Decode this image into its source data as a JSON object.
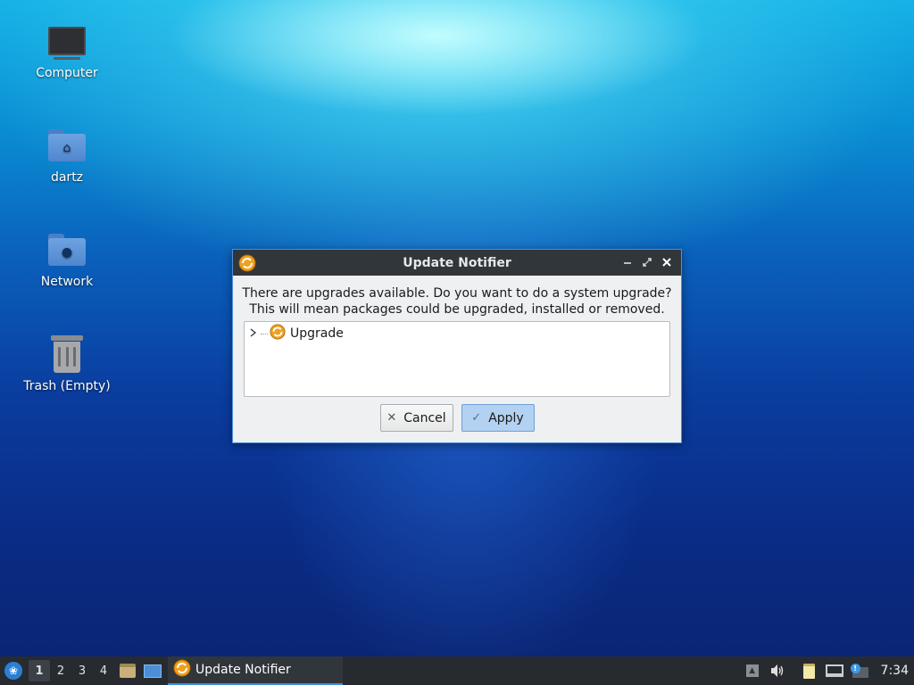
{
  "desktop": {
    "icons": [
      {
        "label": "Computer",
        "icon": "computer-icon"
      },
      {
        "label": "dartz",
        "icon": "home-folder-icon"
      },
      {
        "label": "Network",
        "icon": "network-folder-icon"
      },
      {
        "label": "Trash (Empty)",
        "icon": "trash-icon"
      }
    ]
  },
  "dialog": {
    "title": "Update Notifier",
    "message_line1": "There are upgrades available. Do you want to do a system upgrade?",
    "message_line2": "This will mean packages could be upgraded, installed or removed.",
    "tree": [
      {
        "label": "Upgrade",
        "expanded": false
      }
    ],
    "buttons": {
      "cancel": "Cancel",
      "apply": "Apply"
    },
    "controls": [
      "minimize",
      "maximize",
      "close"
    ]
  },
  "taskbar": {
    "desktops": [
      "1",
      "2",
      "3",
      "4"
    ],
    "active_desktop": "1",
    "task_label": "Update Notifier",
    "clock": "7:34"
  },
  "colors": {
    "titlebar": "#31363b",
    "dialog_border": "#4a90d9",
    "apply_button": "#b3d1f0",
    "taskbar": "#272b30",
    "update_icon": "#f0a020"
  }
}
